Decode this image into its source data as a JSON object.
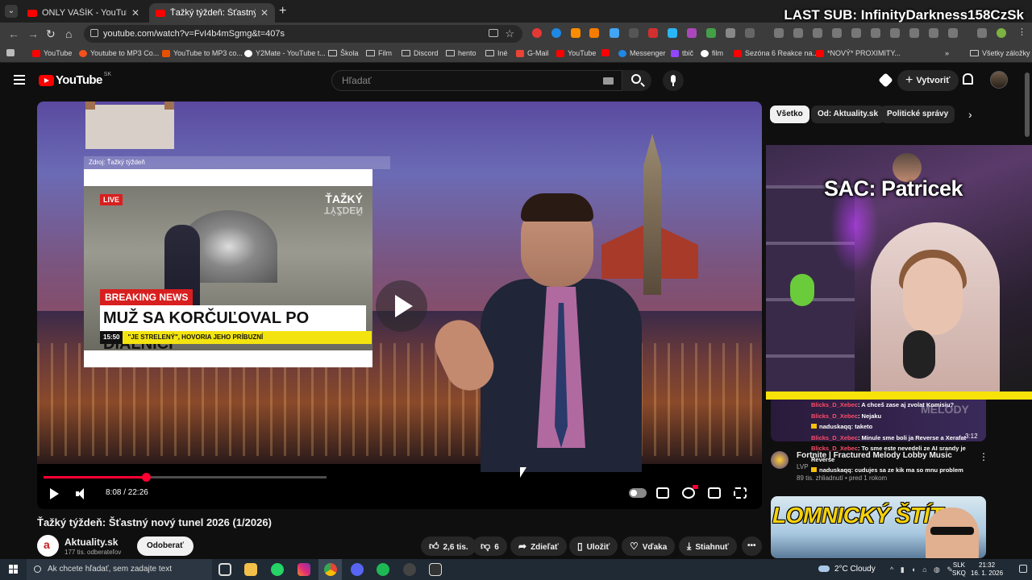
{
  "browser": {
    "tabs": [
      {
        "label": "ONLY VAŠÍK - YouTube",
        "active": false
      },
      {
        "label": "Ťažký týždeň: Šťastný nový tune",
        "active": true
      }
    ],
    "new_tab_label": "+",
    "url": "youtube.com/watch?v=FvI4b4mSgmg&t=407s",
    "bookmarks": [
      {
        "label": "YouTube",
        "icon": "youtube-icon"
      },
      {
        "label": "Youtube to MP3 Co...",
        "icon": "converter-icon"
      },
      {
        "label": "YouTube to MP3 co...",
        "icon": "converter-icon"
      },
      {
        "label": "Y2Mate - YouTube t...",
        "icon": "y2mate-icon"
      },
      {
        "label": "Škola",
        "icon": "folder-icon"
      },
      {
        "label": "Film",
        "icon": "folder-icon"
      },
      {
        "label": "Discord",
        "icon": "folder-icon"
      },
      {
        "label": "hento",
        "icon": "folder-icon"
      },
      {
        "label": "Iné",
        "icon": "folder-icon"
      },
      {
        "label": "G-Mail",
        "icon": "gmail-icon"
      },
      {
        "label": "YouTube",
        "icon": "youtube-icon"
      },
      {
        "label": "",
        "icon": "youtube-icon"
      },
      {
        "label": "Messenger",
        "icon": "messenger-icon"
      },
      {
        "label": "tbič",
        "icon": "twitch-icon"
      },
      {
        "label": "film",
        "icon": "google-icon"
      },
      {
        "label": "Sezóna 6 Reakce na...",
        "icon": "youtube-icon"
      },
      {
        "label": "*NOVÝ* PROXIMITY...",
        "icon": "youtube-icon"
      }
    ],
    "all_bookmarks_label": "Všetky záložky"
  },
  "overlay": {
    "last_sub": "LAST SUB: InfinityDarkness158CzSk",
    "sac": "SAC: Patricek",
    "chat": [
      {
        "user": "Blicks_D_Xebec",
        "text": ": A chceš zase aj zvolat Komisiu?"
      },
      {
        "user": "Blicks_D_Xebec",
        "text": ": Nejaku"
      },
      {
        "user": "naduskaqq",
        "text": ": taketo",
        "badge": true
      },
      {
        "user": "Blicks_D_Xebec",
        "text": ": Minule sme boli ja Reverse a Xerafat"
      },
      {
        "user": "Blicks_D_Xebec",
        "text": ": To sme este nevedeli ze AI srandy je Reverse"
      },
      {
        "user": "naduskaqq",
        "text": ": cudujes sa ze kik ma so mnu problem",
        "badge": true
      }
    ]
  },
  "youtube": {
    "logo_text": "YouTube",
    "country": "SK",
    "search_placeholder": "Hľadať",
    "create_label": "Vytvoriť",
    "video": {
      "title": "Ťažký týždeň: Šťastný nový tunel 2026 (1/2026)",
      "time": "8:08 / 22:26",
      "progress_fraction": 0.363,
      "inset_source": "Zdroj: Ťažký týždeň",
      "live_label": "LIVE",
      "tazky_logo_line1": "ŤAŽKÝ",
      "tazky_logo_line2": "TÝŽDEŇ",
      "breaking_news": "BREAKING NEWS",
      "headline": "MUŽ SA KORČUĽOVAL PO DIAĽNICI",
      "ticker_time": "15:50",
      "ticker_text": "\"JE STRELENÝ\", HOVORIA JEHO PRÍBUZNÍ"
    },
    "channel": {
      "name": "Aktuality.sk",
      "subs": "177 tis. odberateľov",
      "avatar_letter": "a",
      "subscribe_label": "Odoberať"
    },
    "actions": {
      "likes": "2,6 tis.",
      "dislikes": "6",
      "share": "Zdieľať",
      "save": "Uložiť",
      "thanks": "Vďaka",
      "download": "Stiahnuť"
    },
    "chips": [
      "Všetko",
      "Od: Aktuality.sk",
      "Politické správy"
    ],
    "recommendations": [
      {
        "title": "Fortnite | Fractured Melody Lobby Music",
        "channel": "LVP",
        "meta": "89 tis. zhliadnutí • pred 1 rokom",
        "duration": "3:12",
        "thumb_text": "MELODY"
      },
      {
        "thumb_text": "LOMNICKÝ ŠTÍT"
      }
    ]
  },
  "taskbar": {
    "search_placeholder": "Ak chcete hľadať, sem zadajte text",
    "weather": "2°C  Cloudy",
    "lang_line1": "SLK",
    "lang_line2": "SKQ",
    "time": "21:32",
    "date": "16. 1. 2026"
  },
  "colors": {
    "accent": "#ff0033",
    "yt_red": "#ff0000",
    "bg": "#0f0f0f",
    "chrome_bar": "#3c3c3c"
  }
}
